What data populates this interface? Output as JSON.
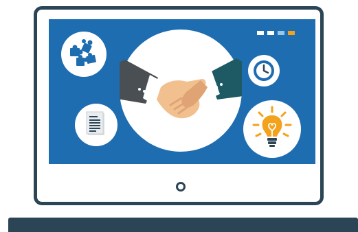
{
  "illustration": {
    "theme": "business partnership / collaboration",
    "icons": [
      "puzzle-icon",
      "document-icon",
      "handshake-icon",
      "clock-icon",
      "lightbulb-icon"
    ]
  },
  "colors": {
    "frame": "#2b4456",
    "screen": "#1e6db0",
    "screen_light": "#9cc6e8",
    "accent": "#f3a21c",
    "sleeve_left": "#4a4f54",
    "sleeve_right": "#1d5a63",
    "skin": "#f2c08e",
    "skin_shadow": "#e0a474",
    "cuff": "#ffffff"
  },
  "indicator_dots": [
    "white",
    "white",
    "light-blue",
    "accent"
  ]
}
